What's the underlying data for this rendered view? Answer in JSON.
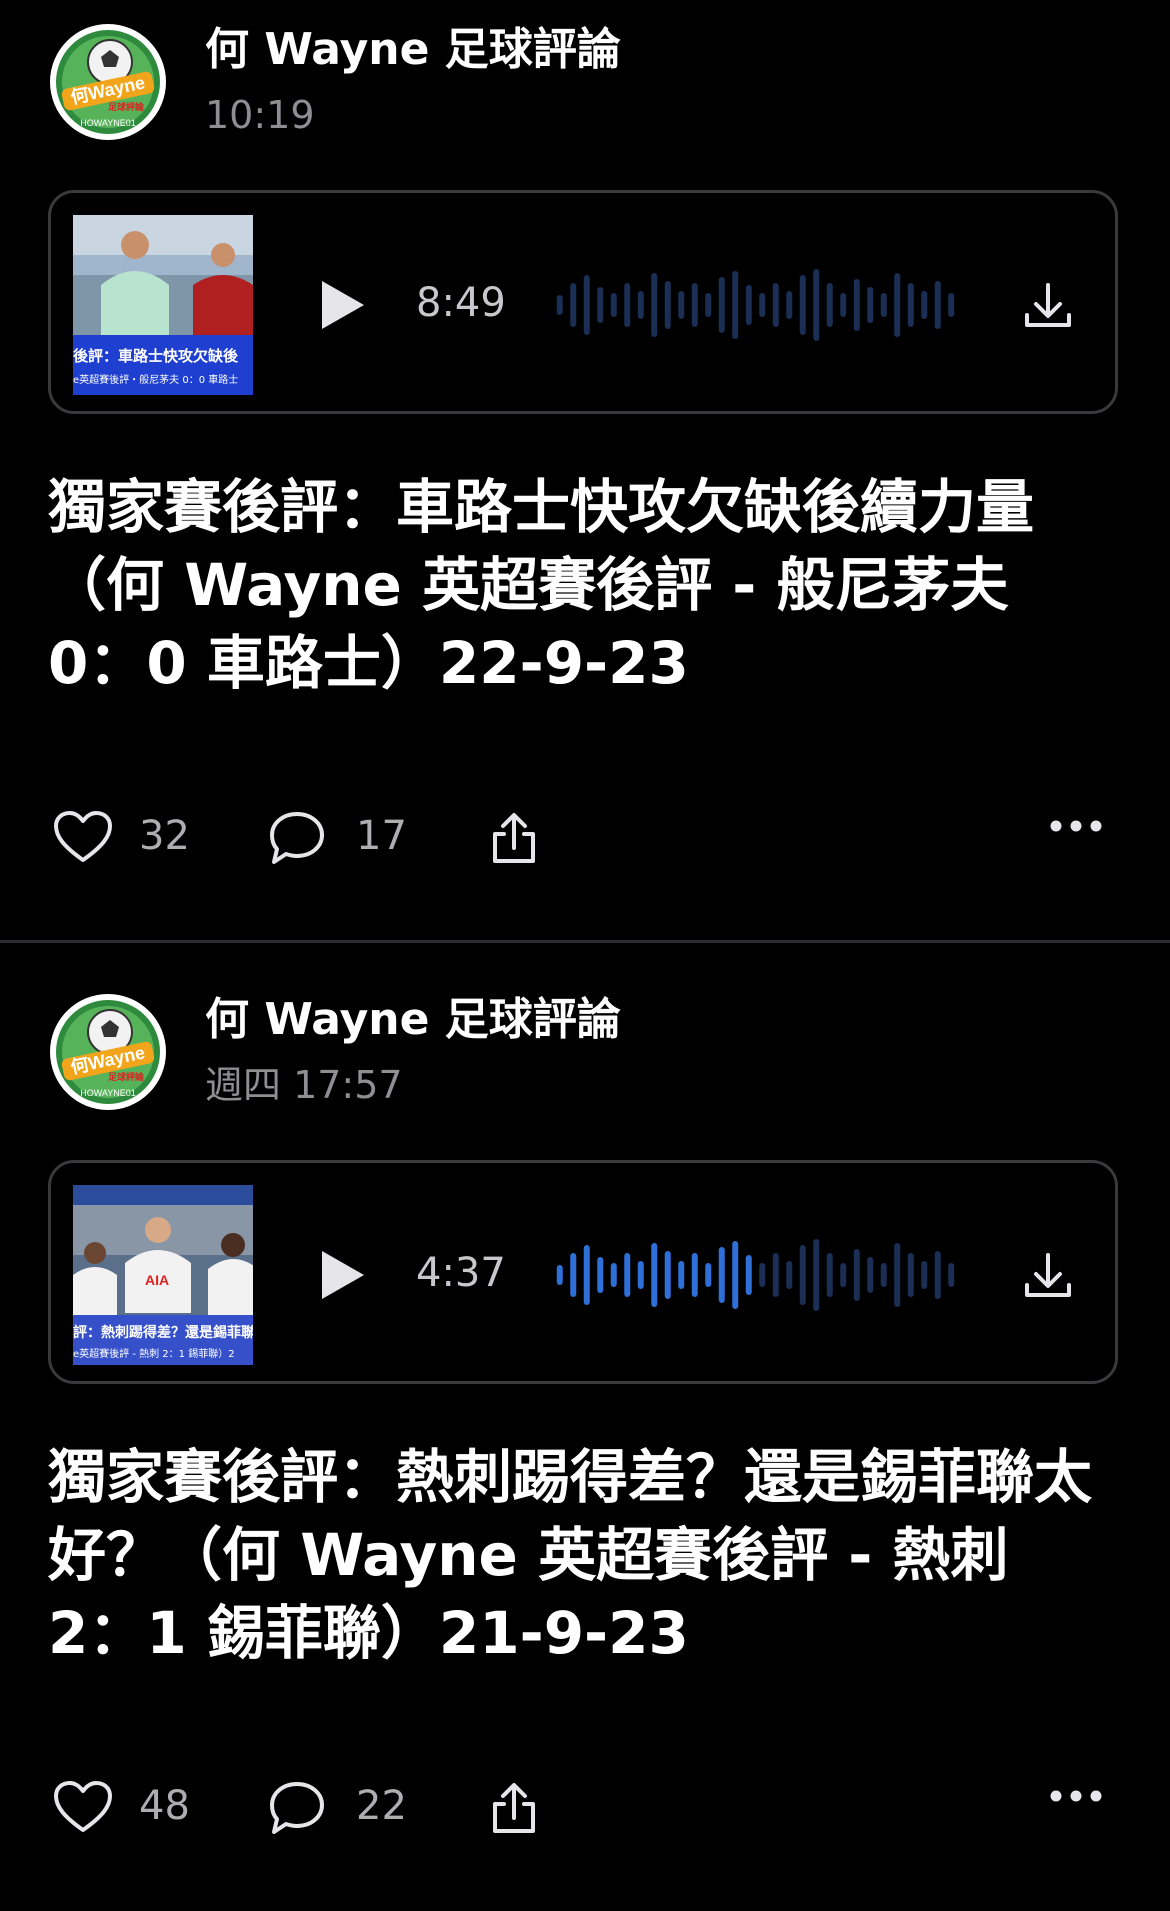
{
  "posts": [
    {
      "author": "何 Wayne 足球評論",
      "timestamp": "10:19",
      "audio": {
        "duration": "8:49",
        "progress": 0,
        "thumbnail_caption": "後評：車路士快攻欠缺後",
        "thumbnail_subcaption": "e英超賽後評・般尼茅夫 0：0 車路士"
      },
      "text": "獨家賽後評：車路士快攻欠缺後續力量（何 Wayne 英超賽後評 - 般尼茅夫 0：0 車路士）22-9-23",
      "likes": "32",
      "replies": "17"
    },
    {
      "author": "何 Wayne 足球評論",
      "timestamp": "週四 17:57",
      "audio": {
        "duration": "4:37",
        "progress": 0.5,
        "thumbnail_caption": "評：熱刺踢得差？還是錫菲聯",
        "thumbnail_subcaption": "e英超賽後評 - 熱刺 2：1 錫菲聯）2",
        "thumbnail_sponsor": "AIA"
      },
      "text": "獨家賽後評：熱刺踢得差？還是錫菲聯太好？（何 Wayne 英超賽後評 - 熱刺 2：1 錫菲聯）21-9-23",
      "likes": "48",
      "replies": "22"
    }
  ],
  "avatar_logo": {
    "name": "何Wayne",
    "subtitle": "足球評論",
    "handle": "HOWAYNE01"
  },
  "colors": {
    "background": "#000000",
    "card_border": "#3a3a3c",
    "waveform_played": "#2f6fd8",
    "waveform_unplayed": "#1b2f55",
    "secondary_text": "#8e8e93",
    "divider": "#2c2c2e"
  },
  "icons": [
    "avatar-logo",
    "play-icon",
    "download-icon",
    "heart-icon",
    "reply-bubble-icon",
    "share-icon",
    "more-icon"
  ]
}
